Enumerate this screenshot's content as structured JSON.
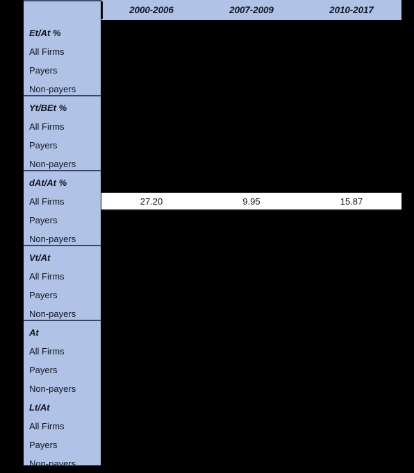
{
  "table": {
    "stub_header": "",
    "columns": [
      "2000-2006",
      "2007-2009",
      "2010-2017"
    ],
    "colors": {
      "panel_blue": "#b0c2e6",
      "rule": "#34456a",
      "highlight": "#ffffff",
      "background": "#000000",
      "text": "#10151f"
    },
    "row_labels": {
      "all_firms": "All Firms",
      "payers": "Payers",
      "non_payers": "Non-payers"
    },
    "groups": [
      {
        "title": "Et/At %",
        "rows": [
          {
            "label": "All Firms",
            "values": [
              "",
              "",
              ""
            ],
            "highlight": false
          },
          {
            "label": "Payers",
            "values": [
              "",
              "",
              ""
            ],
            "highlight": false
          },
          {
            "label": "Non-payers",
            "values": [
              "",
              "",
              ""
            ],
            "highlight": false
          }
        ]
      },
      {
        "title": "Yt/BEt %",
        "rows": [
          {
            "label": "All Firms",
            "values": [
              "",
              "",
              ""
            ],
            "highlight": false
          },
          {
            "label": "Payers",
            "values": [
              "",
              "",
              ""
            ],
            "highlight": false
          },
          {
            "label": "Non-payers",
            "values": [
              "",
              "",
              ""
            ],
            "highlight": false
          }
        ]
      },
      {
        "title": "dAt/At %",
        "rows": [
          {
            "label": "All Firms",
            "values": [
              "27.20",
              "9.95",
              "15.87"
            ],
            "highlight": true
          },
          {
            "label": "Payers",
            "values": [
              "",
              "",
              ""
            ],
            "highlight": false
          },
          {
            "label": "Non-payers",
            "values": [
              "",
              "",
              ""
            ],
            "highlight": false
          }
        ]
      },
      {
        "title": "Vt/At",
        "rows": [
          {
            "label": "All Firms",
            "values": [
              "",
              "",
              ""
            ],
            "highlight": false
          },
          {
            "label": "Payers",
            "values": [
              "",
              "",
              ""
            ],
            "highlight": false
          },
          {
            "label": "Non-payers",
            "values": [
              "",
              "",
              ""
            ],
            "highlight": false
          }
        ]
      },
      {
        "title": "At",
        "rows": [
          {
            "label": "All Firms",
            "values": [
              "",
              "",
              ""
            ],
            "highlight": false
          },
          {
            "label": "Payers",
            "values": [
              "",
              "",
              ""
            ],
            "highlight": false
          },
          {
            "label": "Non-payers",
            "values": [
              "",
              "",
              ""
            ],
            "highlight": false
          }
        ]
      },
      {
        "title": "Lt/At",
        "rows": [
          {
            "label": "All Firms",
            "values": [
              "",
              "",
              ""
            ],
            "highlight": false
          },
          {
            "label": "Payers",
            "values": [
              "",
              "",
              ""
            ],
            "highlight": false
          },
          {
            "label": "Non-payers",
            "values": [
              "",
              "",
              ""
            ],
            "highlight": false
          }
        ]
      }
    ]
  }
}
